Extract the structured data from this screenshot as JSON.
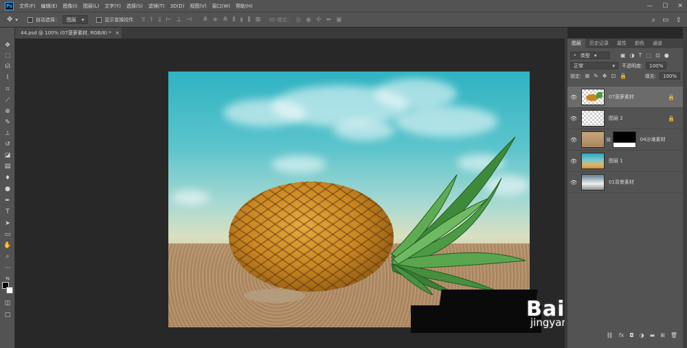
{
  "app": {
    "logo_text": "Ps"
  },
  "menu": [
    "文件(F)",
    "编辑(E)",
    "图像(I)",
    "图层(L)",
    "文字(Y)",
    "选择(S)",
    "滤镜(T)",
    "3D(D)",
    "视图(V)",
    "窗口(W)",
    "帮助(H)"
  ],
  "window_controls": {
    "minimize": "—",
    "maximize": "☐",
    "close": "✕"
  },
  "options_bar": {
    "auto_select_label": "自动选择：",
    "auto_select_target": "图层",
    "show_transform_label": "显示变换控件",
    "mode_3d_label": "3D 模式："
  },
  "document_tab": {
    "title": "44.psd @ 100% (07菠萝素材, RGB/8) *",
    "close": "×"
  },
  "panel_tabs": [
    "图层",
    "历史记录",
    "属性",
    "颜色",
    "通道"
  ],
  "layers_panel": {
    "filter_kind": "类型",
    "blend_mode": "正常",
    "opacity_label": "不透明度:",
    "opacity_value": "100%",
    "lock_label": "锁定:",
    "fill_label": "填充:",
    "fill_value": "100%",
    "layers": [
      {
        "name": "07菠萝素材",
        "selected": true,
        "locked": true
      },
      {
        "name": "图层 2",
        "selected": false,
        "locked": true
      },
      {
        "name": "04沙滩素材",
        "selected": false,
        "locked": false
      },
      {
        "name": "图层 1",
        "selected": false,
        "locked": false
      },
      {
        "name": "01背景素材",
        "selected": false,
        "locked": false
      }
    ]
  },
  "watermark": {
    "brand": "Bai du 经验",
    "url": "jingyan.baidu.com"
  },
  "colors": {
    "ui_dark": "#282828",
    "ui_panel": "#535353",
    "selected_layer": "#6b6b6b",
    "ps_blue": "#31a8ff"
  }
}
